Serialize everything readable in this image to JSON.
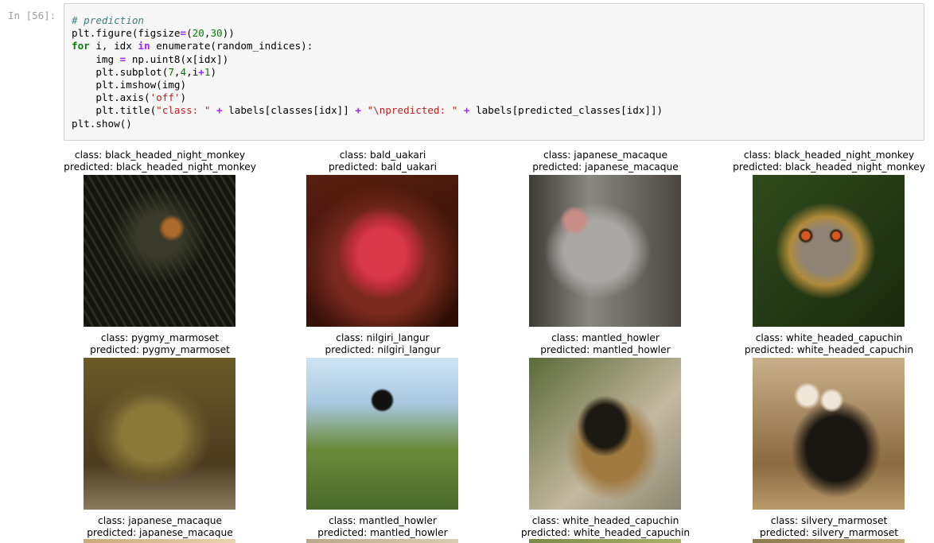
{
  "cell": {
    "prompt": "In [56]:",
    "lines": [
      [
        {
          "t": "# prediction",
          "c": "comment"
        }
      ],
      [
        {
          "t": "plt.figure(figsize",
          "c": "plain"
        },
        {
          "t": "=",
          "c": "op"
        },
        {
          "t": "(",
          "c": "plain"
        },
        {
          "t": "20",
          "c": "num"
        },
        {
          "t": ",",
          "c": "plain"
        },
        {
          "t": "30",
          "c": "num"
        },
        {
          "t": "))",
          "c": "plain"
        }
      ],
      [
        {
          "t": "for",
          "c": "keyword"
        },
        {
          "t": " i, idx ",
          "c": "plain"
        },
        {
          "t": "in",
          "c": "op"
        },
        {
          "t": " enumerate(random_indices):",
          "c": "plain"
        }
      ],
      [
        {
          "t": "    img ",
          "c": "plain"
        },
        {
          "t": "=",
          "c": "op"
        },
        {
          "t": " np.uint8(x[idx])",
          "c": "plain"
        }
      ],
      [
        {
          "t": "    plt.subplot(",
          "c": "plain"
        },
        {
          "t": "7",
          "c": "num"
        },
        {
          "t": ",",
          "c": "plain"
        },
        {
          "t": "4",
          "c": "num"
        },
        {
          "t": ",i",
          "c": "plain"
        },
        {
          "t": "+",
          "c": "op"
        },
        {
          "t": "1",
          "c": "num"
        },
        {
          "t": ")",
          "c": "plain"
        }
      ],
      [
        {
          "t": "    plt.imshow(img)",
          "c": "plain"
        }
      ],
      [
        {
          "t": "    plt.axis(",
          "c": "plain"
        },
        {
          "t": "'off'",
          "c": "str"
        },
        {
          "t": ")",
          "c": "plain"
        }
      ],
      [
        {
          "t": "    plt.title(",
          "c": "plain"
        },
        {
          "t": "\"class: \"",
          "c": "str"
        },
        {
          "t": " ",
          "c": "plain"
        },
        {
          "t": "+",
          "c": "op"
        },
        {
          "t": " labels[classes[idx]] ",
          "c": "plain"
        },
        {
          "t": "+",
          "c": "op"
        },
        {
          "t": " ",
          "c": "plain"
        },
        {
          "t": "\"\\npredicted: \"",
          "c": "str"
        },
        {
          "t": " ",
          "c": "plain"
        },
        {
          "t": "+",
          "c": "op"
        },
        {
          "t": " labels[predicted_classes[idx]])",
          "c": "plain"
        }
      ],
      [
        {
          "t": "plt.show()",
          "c": "plain"
        }
      ]
    ]
  },
  "output": {
    "panels": [
      {
        "class_line": "class: black_headed_night_monkey",
        "predicted_line": "predicted: black_headed_night_monkey",
        "photo": "night-monkey-photo"
      },
      {
        "class_line": "class: bald_uakari",
        "predicted_line": "predicted: bald_uakari",
        "photo": "bald-uakari-photo"
      },
      {
        "class_line": "class: japanese_macaque",
        "predicted_line": "predicted: japanese_macaque",
        "photo": "japanese-macaque-photo"
      },
      {
        "class_line": "class: black_headed_night_monkey",
        "predicted_line": "predicted: black_headed_night_monkey",
        "photo": "night-monkey-photo"
      },
      {
        "class_line": "class: pygmy_marmoset",
        "predicted_line": "predicted: pygmy_marmoset",
        "photo": "pygmy-marmoset-photo"
      },
      {
        "class_line": "class: nilgiri_langur",
        "predicted_line": "predicted: nilgiri_langur",
        "photo": "nilgiri-langur-photo"
      },
      {
        "class_line": "class: mantled_howler",
        "predicted_line": "predicted: mantled_howler",
        "photo": "mantled-howler-photo"
      },
      {
        "class_line": "class: white_headed_capuchin",
        "predicted_line": "predicted: white_headed_capuchin",
        "photo": "white-headed-capuchin-photo"
      },
      {
        "class_line": "class: japanese_macaque",
        "predicted_line": "predicted: japanese_macaque",
        "photo": "japanese-macaque-photo"
      },
      {
        "class_line": "class: mantled_howler",
        "predicted_line": "predicted: mantled_howler",
        "photo": "mantled-howler-photo"
      },
      {
        "class_line": "class: white_headed_capuchin",
        "predicted_line": "predicted: white_headed_capuchin",
        "photo": "white-headed-capuchin-photo"
      },
      {
        "class_line": "class: silvery_marmoset",
        "predicted_line": "predicted: silvery_marmoset",
        "photo": "silvery-marmoset-photo"
      }
    ]
  }
}
